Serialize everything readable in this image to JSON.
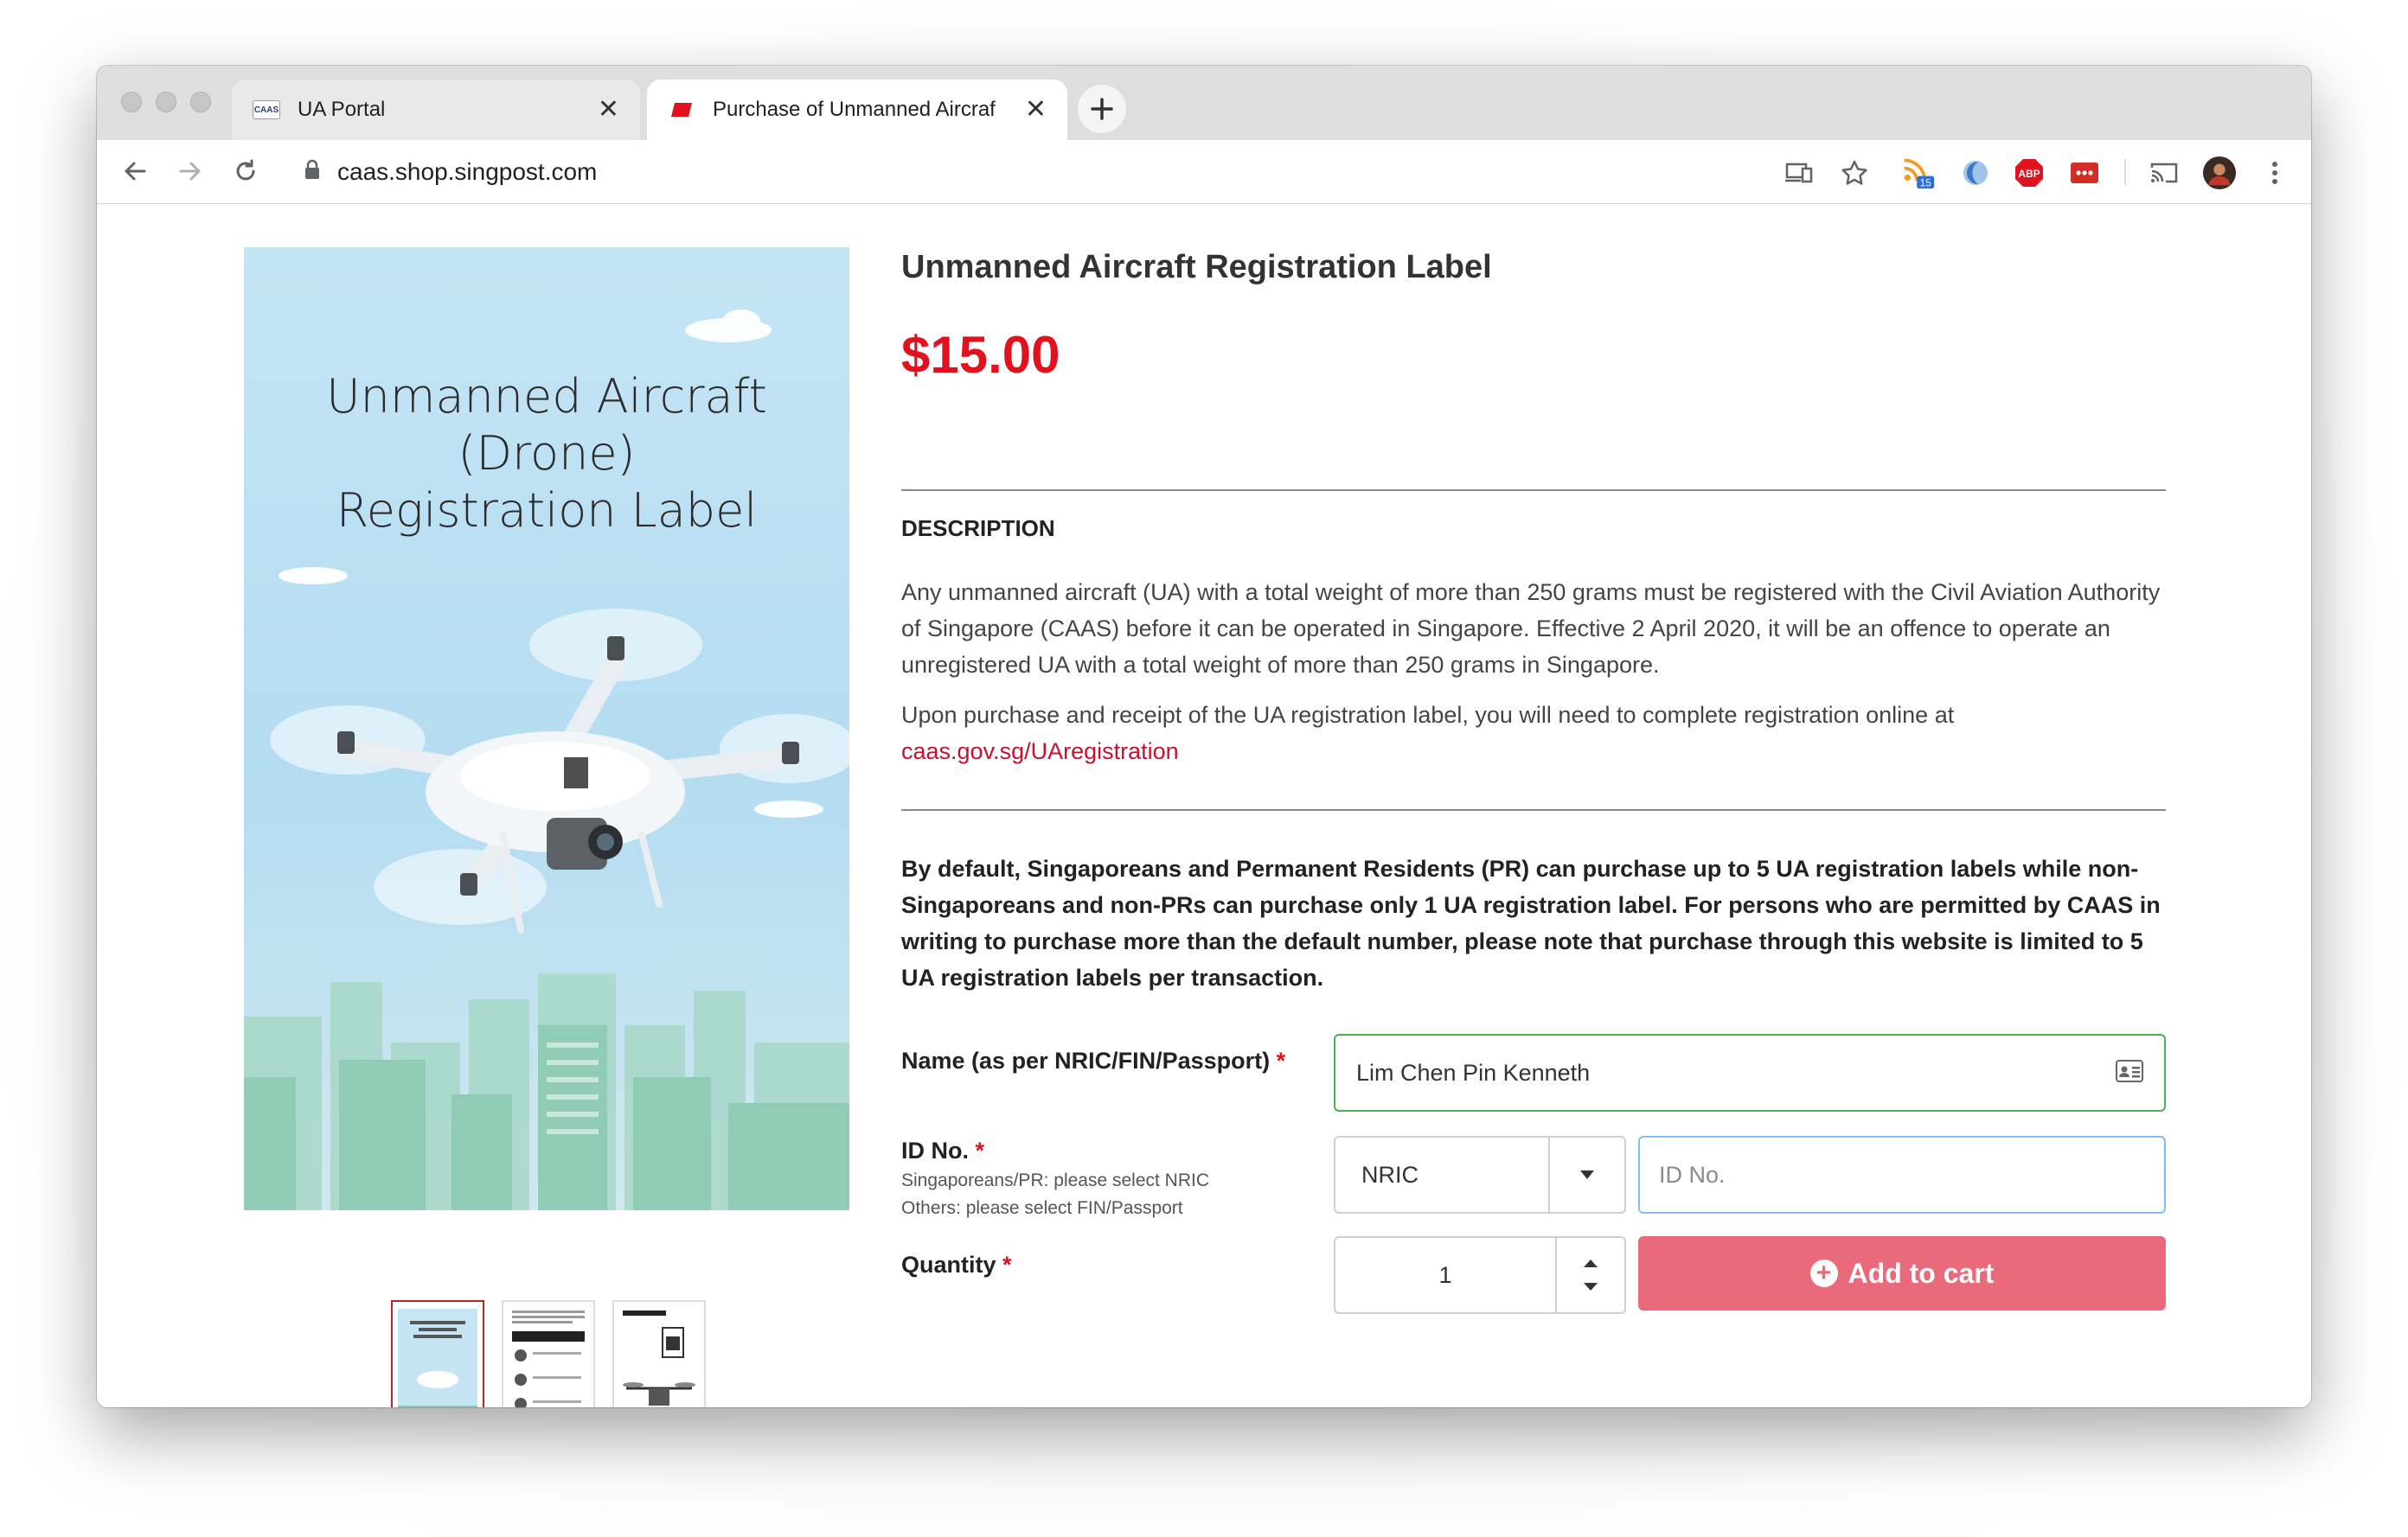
{
  "browser": {
    "tabs": [
      {
        "label": "UA Portal",
        "favicon_text": "CAAS"
      },
      {
        "label": "Purchase of Unmanned Aircraf"
      }
    ],
    "url": "caas.shop.singpost.com",
    "extension_badge": "15",
    "abp_label": "ABP"
  },
  "product": {
    "image_title_lines": [
      "Unmanned Aircraft",
      "(Drone)",
      "Registration Label"
    ],
    "title": "Unmanned Aircraft Registration Label",
    "price": "$15.00",
    "description_heading": "DESCRIPTION",
    "description_p1": "Any unmanned aircraft (UA) with a total weight of more than 250 grams must be registered with the Civil Aviation Authority of Singapore (CAAS) before it can be operated in Singapore. Effective 2 April 2020, it will be an offence to operate an unregistered UA with a total weight of more than 250 grams in Singapore.",
    "description_p2": "Upon purchase and receipt of the UA registration label, you will need to complete registration online at",
    "description_link": "caas.gov.sg/UAregistration",
    "notice": "By default, Singaporeans and Permanent Residents (PR) can purchase up to 5 UA registration labels while non-Singaporeans and non-PRs can purchase only 1 UA registration label. For persons who are permitted by CAAS in writing to purchase more than the default number, please note that purchase through this website is limited to 5 UA registration labels per transaction."
  },
  "form": {
    "name_label": "Name (as per NRIC/FIN/Passport)",
    "name_value": "Lim Chen Pin Kenneth",
    "id_label": "ID No.",
    "id_hint_1": "Singaporeans/PR: please select NRIC",
    "id_hint_2": "Others: please select FIN/Passport",
    "id_type_selected": "NRIC",
    "id_placeholder": "ID No.",
    "quantity_label": "Quantity",
    "quantity_value": "1",
    "required_mark": "*",
    "add_to_cart": "Add to cart"
  },
  "colors": {
    "price": "#e2111e",
    "add_to_cart": "#e96b7b",
    "name_field_border": "#4caf50",
    "link": "#c8102e"
  }
}
